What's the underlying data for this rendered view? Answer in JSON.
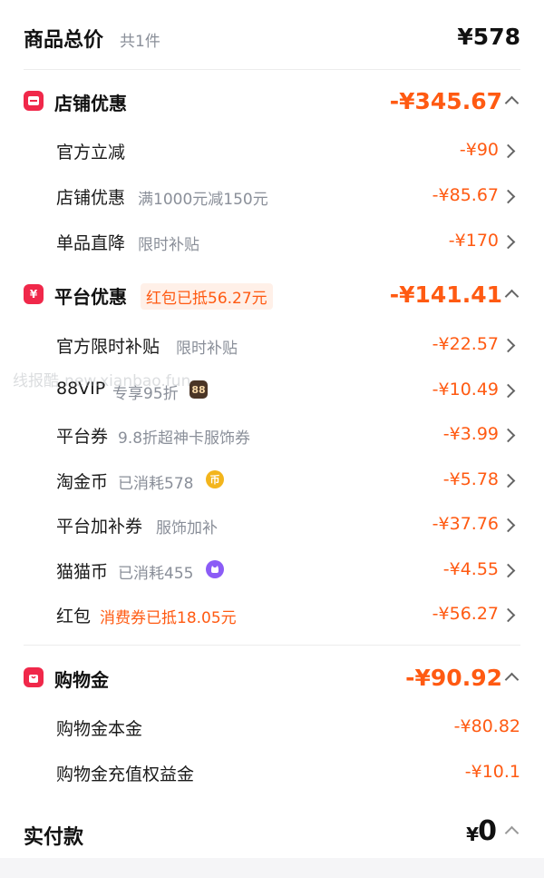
{
  "summary": {
    "title": "商品总价",
    "count": "共1件",
    "total": "¥578"
  },
  "store_section": {
    "title": "店铺优惠",
    "amount": "-¥345.67",
    "items": [
      {
        "label": "官方立减",
        "sub": "",
        "amount": "-¥90"
      },
      {
        "label": "店铺优惠",
        "sub": "满1000元减150元",
        "amount": "-¥85.67"
      },
      {
        "label": "单品直降",
        "sub": "限时补贴",
        "amount": "-¥170"
      }
    ]
  },
  "platform_section": {
    "title": "平台优惠",
    "tag": "红包已抵56.27元",
    "amount": "-¥141.41",
    "items": [
      {
        "label": "官方限时补贴",
        "sub": "限时补贴",
        "amount": "-¥22.57"
      },
      {
        "label": "88VIP",
        "sub": "专享95折",
        "badge": "88",
        "amount": "-¥10.49"
      },
      {
        "label": "平台券",
        "sub": "9.8折超神卡服饰券",
        "amount": "-¥3.99"
      },
      {
        "label": "淘金币",
        "sub": "已消耗578",
        "coin": "币",
        "amount": "-¥5.78"
      },
      {
        "label": "平台加补券",
        "sub": "服饰加补",
        "amount": "-¥37.76"
      },
      {
        "label": "猫猫币",
        "sub": "已消耗455",
        "amount": "-¥4.55"
      },
      {
        "label": "红包",
        "sub": "消费券已抵18.05元",
        "amount": "-¥56.27"
      }
    ]
  },
  "shopping_section": {
    "title": "购物金",
    "amount": "-¥90.92",
    "items": [
      {
        "label": "购物金本金",
        "amount": "-¥80.82"
      },
      {
        "label": "购物金充值权益金",
        "amount": "-¥10.1"
      }
    ]
  },
  "payment": {
    "label": "实付款",
    "currency": "¥",
    "amount": "0"
  },
  "watermark": "线报酷-new.xianbao.fun",
  "colors": {
    "accent_orange": "#ff5a12",
    "icon_red": "#f0284a",
    "coin_gold": "#f3b51c",
    "coin_purple": "#8b5cf6"
  },
  "icons": [
    "store-icon",
    "platform-coupon-icon",
    "shopping-bag-icon",
    "chevron-right-icon",
    "chevron-up-icon",
    "gold-coin-icon",
    "cat-coin-icon",
    "vip88-badge-icon"
  ]
}
